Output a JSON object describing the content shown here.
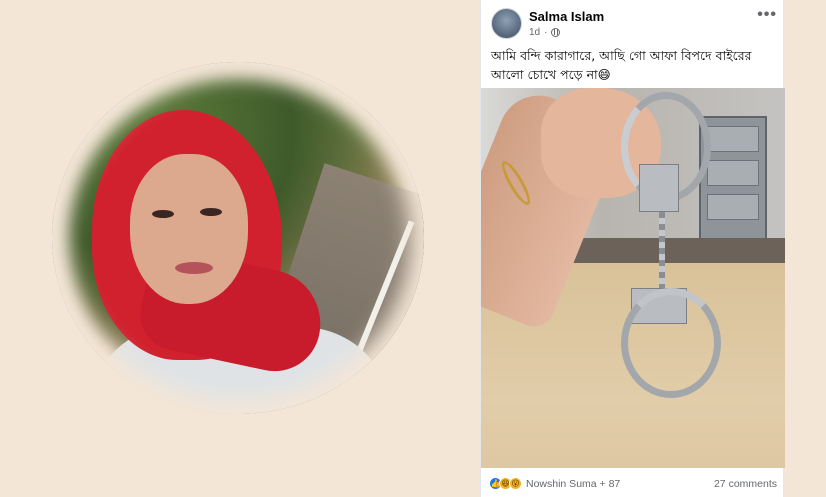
{
  "post": {
    "author": "Salma Islam",
    "time": "1d",
    "more_icon": "more-horizontal-icon",
    "audience_icon": "globe-icon",
    "caption": "আমি বন্দি কারাগারে, আছি গো আফা  বিপদে বাইরের আলো চোখে পড়ে না😄",
    "reactions": {
      "icons": [
        "like-icon",
        "haha-icon",
        "wow-icon"
      ],
      "summary": "Nowshin Suma + 87"
    },
    "comments": "27 comments"
  }
}
